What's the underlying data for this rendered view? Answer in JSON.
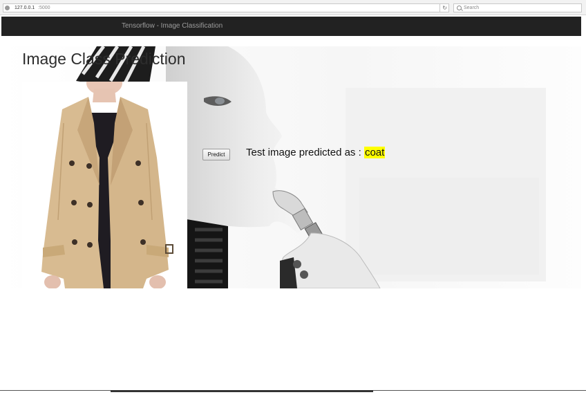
{
  "browser": {
    "url_host": "127.0.0.1",
    "url_port": ":5000",
    "search_placeholder": "Search"
  },
  "navbar": {
    "brand": "Tensorflow - Image Classification"
  },
  "main": {
    "title": "Image Class Prediction",
    "predict_button": "Predict",
    "result_prefix": "Test image predicted as :",
    "result_label": "coat"
  },
  "icons": {
    "globe": "globe-icon",
    "reload": "reload-icon",
    "search": "search-icon"
  },
  "colors": {
    "navbar": "#222222",
    "highlight": "#ffff00"
  }
}
